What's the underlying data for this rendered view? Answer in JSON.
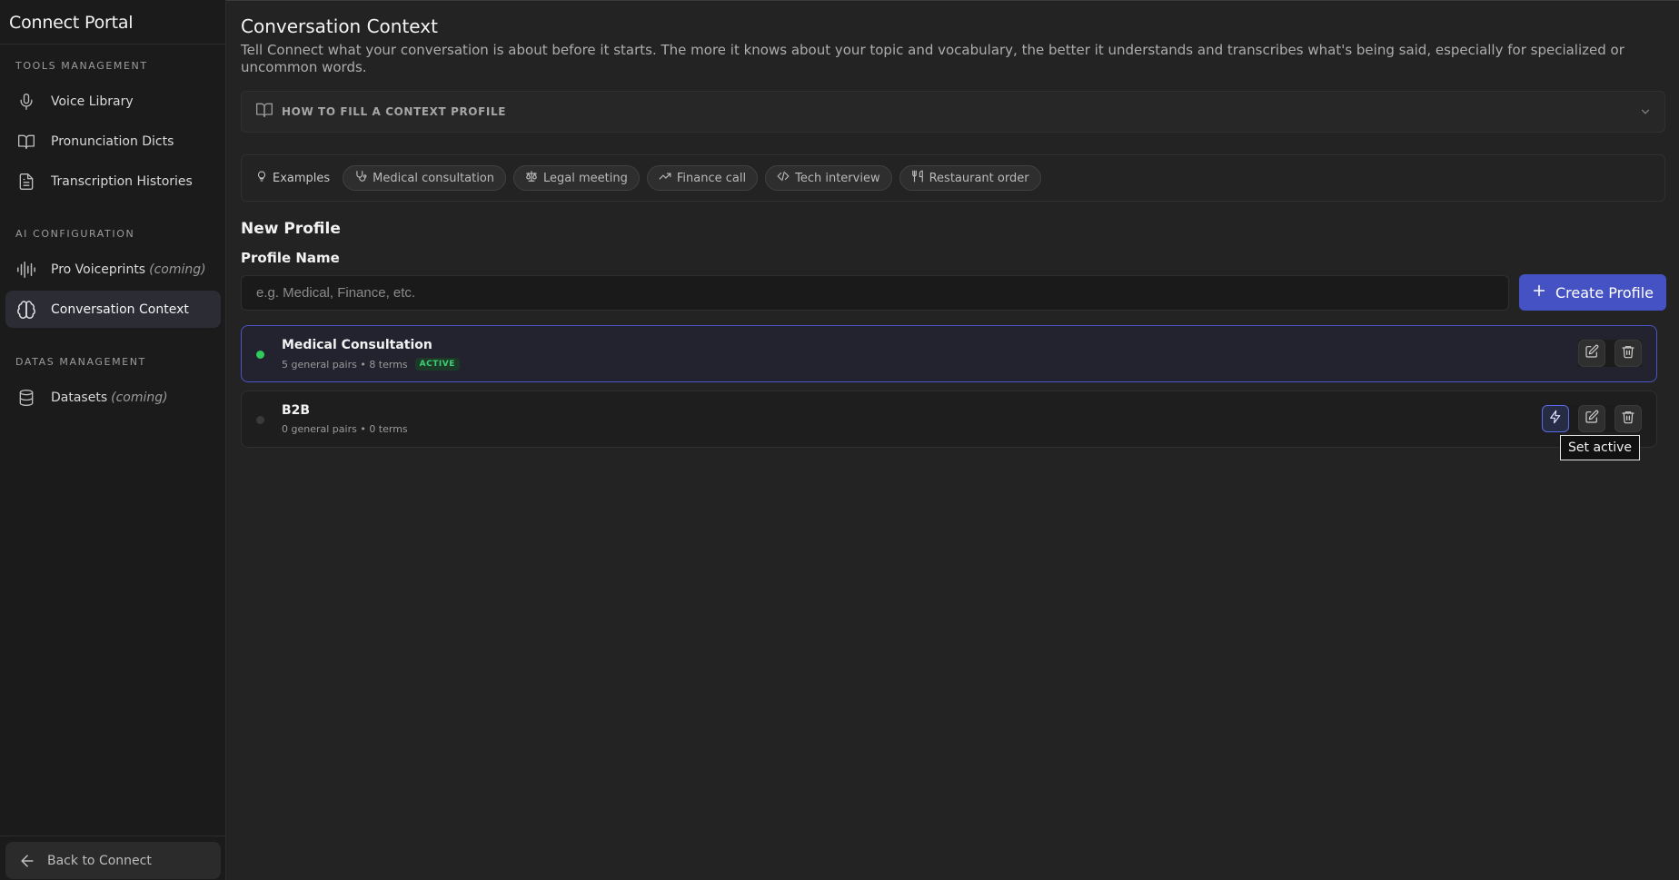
{
  "app": {
    "brand": "Connect Portal"
  },
  "sidebar": {
    "sections": [
      {
        "title": "TOOLS MANAGEMENT"
      },
      {
        "title": "AI CONFIGURATION"
      },
      {
        "title": "DATAS MANAGEMENT"
      }
    ],
    "items": [
      {
        "label": "Voice Library",
        "icon": "microphone-icon"
      },
      {
        "label": "Pronunciation Dicts",
        "icon": "book-icon"
      },
      {
        "label": "Transcription Histories",
        "icon": "document-icon"
      },
      {
        "label": "Pro Voiceprints",
        "suffix": "(coming)",
        "icon": "waveform-icon"
      },
      {
        "label": "Conversation Context",
        "icon": "brain-icon",
        "active": true
      },
      {
        "label": "Datasets",
        "suffix": "(coming)",
        "icon": "database-icon"
      }
    ],
    "back_label": "Back to Connect"
  },
  "main": {
    "title": "Conversation Context",
    "description": "Tell Connect what your conversation is about before it starts. The more it knows about your topic and vocabulary, the better it understands and transcribes what's being said, especially for specialized or uncommon words.",
    "howto_label": "HOW TO FILL A CONTEXT PROFILE",
    "examples_label": "Examples",
    "examples": [
      {
        "label": "Medical consultation",
        "icon": "stethoscope-icon"
      },
      {
        "label": "Legal meeting",
        "icon": "scale-icon"
      },
      {
        "label": "Finance call",
        "icon": "trending-up-icon"
      },
      {
        "label": "Tech interview",
        "icon": "code-icon"
      },
      {
        "label": "Restaurant order",
        "icon": "utensils-icon"
      }
    ],
    "new_profile_title": "New Profile",
    "profile_name_label": "Profile Name",
    "profile_name_placeholder": "e.g. Medical, Finance, etc.",
    "create_label": "Create Profile"
  },
  "profiles": [
    {
      "name": "Medical Consultation",
      "meta": "5 general pairs • 8 terms",
      "badge": "ACTIVE",
      "status_color": "#2ecc5b"
    },
    {
      "name": "B2B",
      "meta": "0 general pairs • 0 terms",
      "status_color": "#3a3a3a"
    }
  ],
  "tooltip": "Set active",
  "colors": {
    "accent": "#4452c4",
    "active_green": "#3fcf74"
  }
}
